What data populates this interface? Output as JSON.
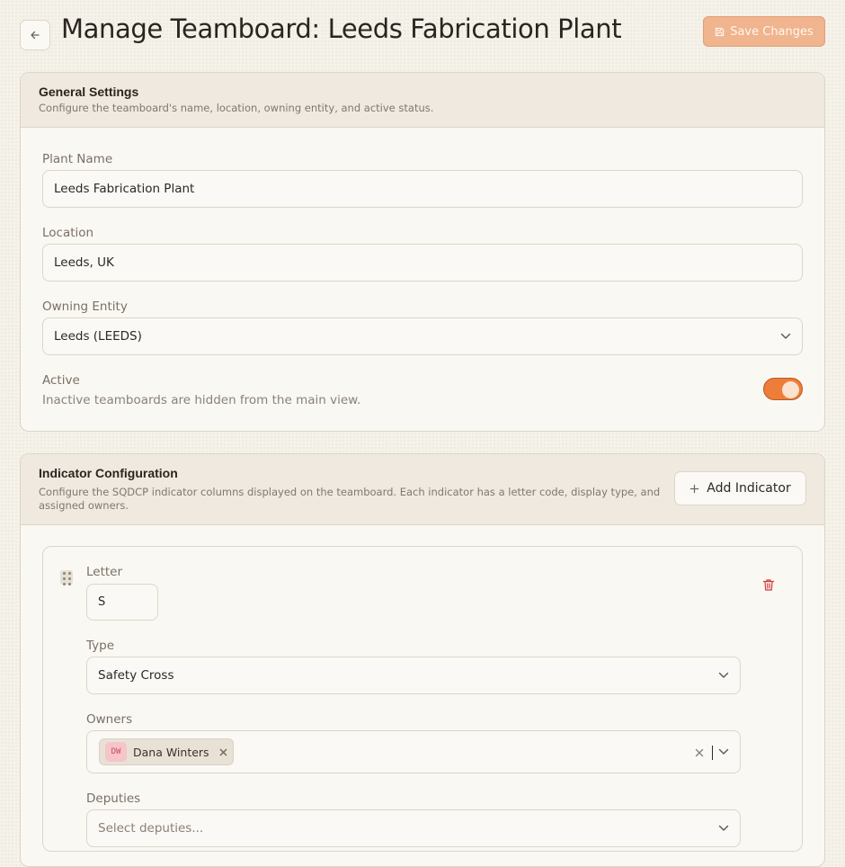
{
  "header": {
    "back_icon": "arrow-left-icon",
    "title": "Manage Teamboard: Leeds Fabrication Plant",
    "save_label": "Save Changes",
    "save_icon": "save-icon"
  },
  "general": {
    "title": "General Settings",
    "subtitle": "Configure the teamboard's name, location, owning entity, and active status.",
    "plant_name_label": "Plant Name",
    "plant_name_value": "Leeds Fabrication Plant",
    "location_label": "Location",
    "location_value": "Leeds, UK",
    "entity_label": "Owning Entity",
    "entity_value": "Leeds (LEEDS)",
    "active_label": "Active",
    "active_help": "Inactive teamboards are hidden from the main view.",
    "active_on": true
  },
  "indicators": {
    "title": "Indicator Configuration",
    "subtitle": "Configure the SQDCP indicator columns displayed on the teamboard. Each indicator has a letter code, display type, and assigned owners.",
    "add_label": "Add Indicator",
    "items": [
      {
        "letter_label": "Letter",
        "letter_value": "S",
        "type_label": "Type",
        "type_value": "Safety Cross",
        "owners_label": "Owners",
        "owners": [
          {
            "initials": "DW",
            "name": "Dana Winters"
          }
        ],
        "deputies_label": "Deputies",
        "deputies_placeholder": "Select deputies..."
      }
    ]
  },
  "colors": {
    "accent": "#ee7d3a",
    "save_disabled": "#f0b48e",
    "delete": "#d23a3a",
    "background": "#f5f2ea"
  }
}
